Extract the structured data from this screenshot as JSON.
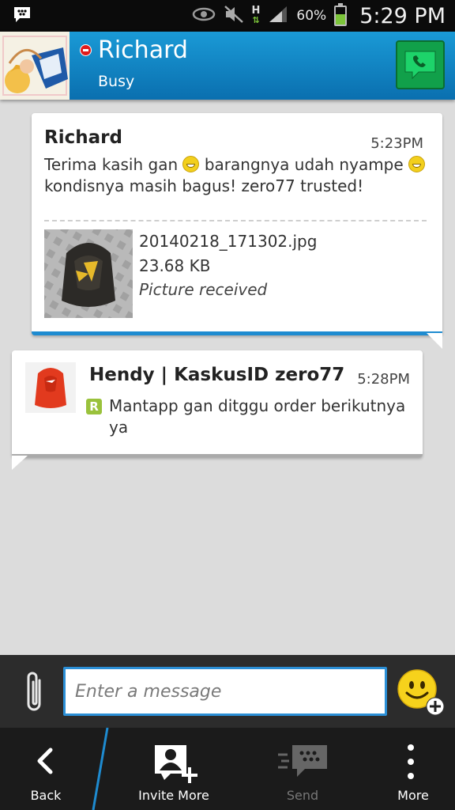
{
  "status_bar": {
    "battery_percent": "60%",
    "battery_level": 0.6,
    "time": "5:29 PM",
    "network_type": "H",
    "icons": [
      "bbm-icon",
      "eye-icon",
      "mute-icon",
      "signal-icon",
      "battery-icon"
    ]
  },
  "header": {
    "contact_name": "Richard",
    "contact_status": "Busy",
    "status_icon": "busy-icon",
    "call_icon": "phone-icon"
  },
  "messages": [
    {
      "sender": "Richard",
      "time": "5:23PM",
      "text_parts": [
        "Terima kasih gan ",
        " barangnya udah nyampe ",
        ""
      ],
      "text_line2": "kondisnya masih bagus! zero77 trusted!",
      "attachment": {
        "filename": "20140218_171302.jpg",
        "size": "23.68 KB",
        "status": "Picture received"
      }
    },
    {
      "sender": "Hendy | KaskusID zero77",
      "time": "5:28PM",
      "read_marker": "R",
      "text": "Mantapp gan ditggu order berikutnya ya"
    }
  ],
  "compose": {
    "placeholder": "Enter a message",
    "attach_icon": "paperclip-icon",
    "emoticon_icon": "emoticon-add-icon"
  },
  "action_bar": {
    "back_label": "Back",
    "invite_label": "Invite More",
    "send_label": "Send",
    "more_label": "More"
  },
  "colors": {
    "header_blue": "#0a8fd2",
    "accent_blue": "#1e8bd0",
    "call_green": "#11a04a",
    "busy_red": "#e01b1b"
  }
}
